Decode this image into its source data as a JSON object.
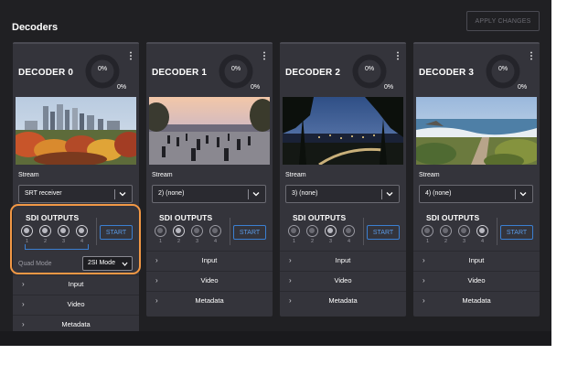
{
  "header": {
    "title": "Decoders",
    "apply_label": "APPLY CHANGES"
  },
  "colors": {
    "accent_blue": "#3b7fd1",
    "highlight_orange": "#f29845",
    "card_bg": "#34343b",
    "app_bg": "#202023"
  },
  "decoders": [
    {
      "title": "DECODER 0",
      "gauge_pct": "0%",
      "gauge_sub": "0%",
      "gauge_value": 0,
      "stream_label": "Stream",
      "stream_value": "SRT receiver",
      "sdi_title": "SDI OUTPUTS",
      "ports": [
        "1",
        "2",
        "3",
        "4"
      ],
      "start_label": "START",
      "quad_label": "Quad Mode",
      "quad_value": "2SI Mode",
      "sections": {
        "input": "Input",
        "video": "Video",
        "metadata": "Metadata"
      },
      "thumbnail": "city-skyline-autumn"
    },
    {
      "title": "DECODER 1",
      "gauge_pct": "0%",
      "gauge_sub": "0%",
      "gauge_value": 0,
      "stream_label": "Stream",
      "stream_value": "2) (none)",
      "sdi_title": "SDI OUTPUTS",
      "ports": [
        "1",
        "2",
        "3",
        "4"
      ],
      "start_label": "START",
      "sections": {
        "input": "Input",
        "video": "Video",
        "metadata": "Metadata"
      },
      "thumbnail": "plaza-crowd-dusk"
    },
    {
      "title": "DECODER 2",
      "gauge_pct": "0%",
      "gauge_sub": "0%",
      "gauge_value": 0,
      "stream_label": "Stream",
      "stream_value": "3) (none)",
      "sdi_title": "SDI OUTPUTS",
      "ports": [
        "1",
        "2",
        "3",
        "4"
      ],
      "start_label": "START",
      "sections": {
        "input": "Input",
        "video": "Video",
        "metadata": "Metadata"
      },
      "thumbnail": "night-city-trees"
    },
    {
      "title": "DECODER 3",
      "gauge_pct": "0%",
      "gauge_sub": "0%",
      "gauge_value": 0,
      "stream_label": "Stream",
      "stream_value": "4) (none)",
      "sdi_title": "SDI OUTPUTS",
      "ports": [
        "1",
        "2",
        "3",
        "4"
      ],
      "start_label": "START",
      "sections": {
        "input": "Input",
        "video": "Video",
        "metadata": "Metadata"
      },
      "thumbnail": "coastal-path-ocean"
    }
  ]
}
